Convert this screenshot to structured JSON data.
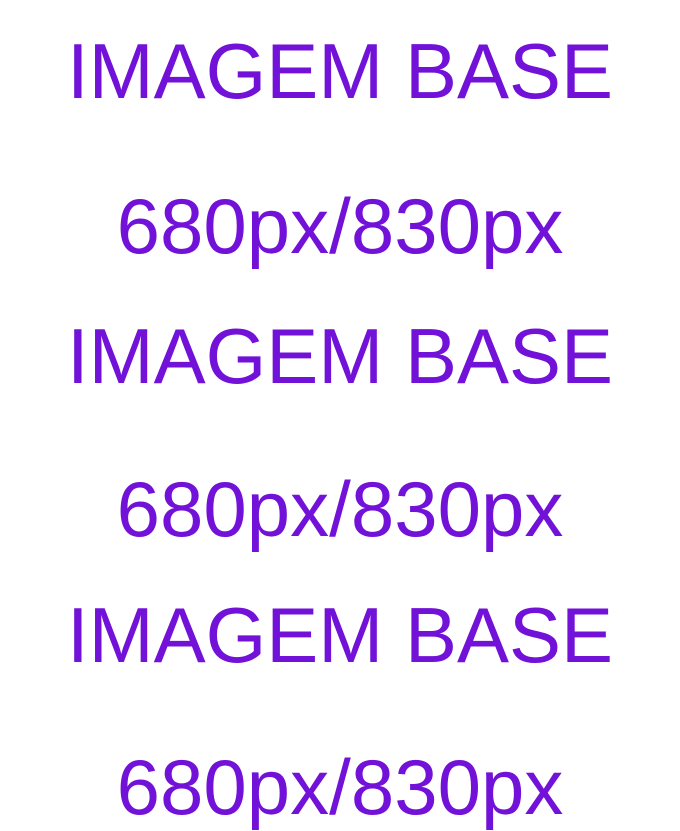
{
  "colors": {
    "text": "#7211d8",
    "background": "#ffffff"
  },
  "lines": [
    "IMAGEM BASE",
    "680px/830px",
    "IMAGEM BASE",
    "680px/830px",
    "IMAGEM BASE",
    "680px/830px"
  ]
}
